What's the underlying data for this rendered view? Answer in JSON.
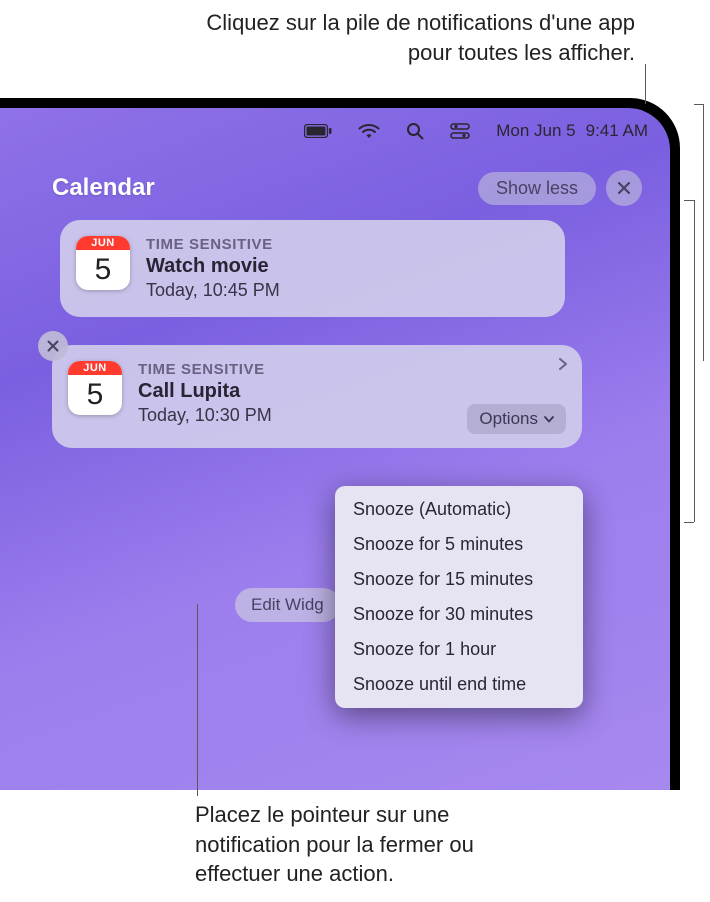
{
  "annotations": {
    "top": "Cliquez sur la pile de notifications d'une app pour toutes les afficher.",
    "bottom": "Placez le pointeur sur une notification pour la fermer ou effectuer une action."
  },
  "menubar": {
    "date": "Mon Jun 5",
    "time": "9:41 AM"
  },
  "notif_header": {
    "app": "Calendar",
    "show_less": "Show less"
  },
  "calendar_icon": {
    "month": "JUN",
    "day": "5"
  },
  "notifications": [
    {
      "badge": "TIME SENSITIVE",
      "title": "Watch movie",
      "subtitle": "Today, 10:45 PM"
    },
    {
      "badge": "TIME SENSITIVE",
      "title": "Call Lupita",
      "subtitle": "Today, 10:30 PM",
      "options_label": "Options"
    }
  ],
  "options_menu": [
    "Snooze (Automatic)",
    "Snooze for 5 minutes",
    "Snooze for 15 minutes",
    "Snooze for 30 minutes",
    "Snooze for 1 hour",
    "Snooze until end time"
  ],
  "edit_widgets": "Edit Widg"
}
